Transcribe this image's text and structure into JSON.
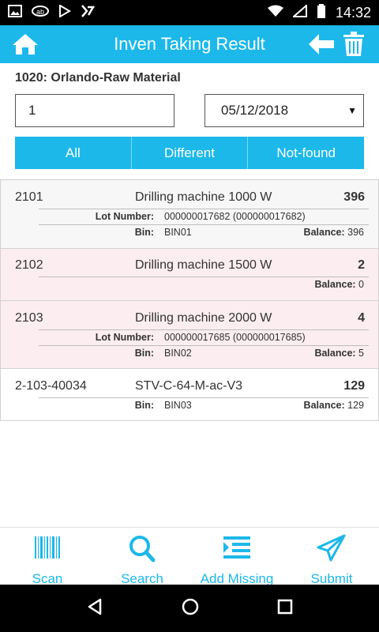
{
  "status": {
    "time": "14:32"
  },
  "appbar": {
    "title": "Inven Taking Result"
  },
  "header": {
    "location": "1020: Orlando-Raw Material",
    "quantity_value": "1",
    "date_value": "05/12/2018"
  },
  "filters": [
    {
      "label": "All"
    },
    {
      "label": "Different"
    },
    {
      "label": "Not-found"
    }
  ],
  "items": [
    {
      "code": "2101",
      "description": "Drilling machine 1000 W",
      "quantity": "396",
      "lot_label": "Lot Number:",
      "lot_value": "000000017682 (000000017682)",
      "bin_label": "Bin:",
      "bin_value": "BIN01",
      "balance_label": "Balance:",
      "balance_value": "396",
      "color": "#f7f7f7"
    },
    {
      "code": "2102",
      "description": "Drilling machine 1500 W",
      "quantity": "2",
      "balance_label": "Balance:",
      "balance_value": "0",
      "color": "#fcedf0"
    },
    {
      "code": "2103",
      "description": "Drilling machine 2000 W",
      "quantity": "4",
      "lot_label": "Lot Number:",
      "lot_value": "000000017685 (000000017685)",
      "bin_label": "Bin:",
      "bin_value": "BIN02",
      "balance_label": "Balance:",
      "balance_value": "5",
      "color": "#fcedf0"
    },
    {
      "code": "2-103-40034",
      "description": "STV-C-64-M-ac-V3",
      "quantity": "129",
      "bin_label": "Bin:",
      "bin_value": "BIN03",
      "balance_label": "Balance:",
      "balance_value": "129",
      "color": "#ffffff"
    }
  ],
  "toolbar": {
    "scan": "Scan",
    "search": "Search",
    "add_missing": "Add Missing",
    "submit": "Submit"
  },
  "colors": {
    "accent": "#1cb8ea",
    "pink_row": "#fcedf0"
  }
}
